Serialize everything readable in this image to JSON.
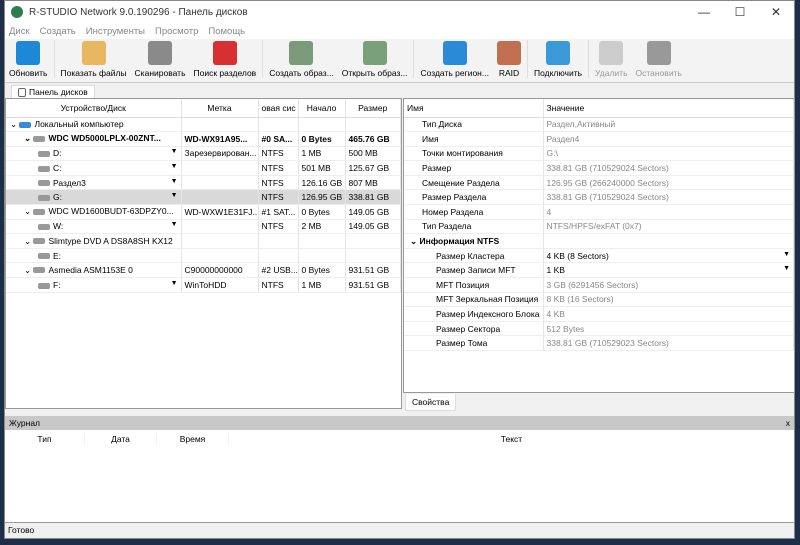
{
  "title": "R-STUDIO Network 9.0.190296 - Панель дисков",
  "menu": [
    "Диск",
    "Создать",
    "Инструменты",
    "Просмотр",
    "Помощь"
  ],
  "toolbar": [
    {
      "label": "Обновить",
      "color": "#1e88d8",
      "disabled": false
    },
    {
      "label": "Показать файлы",
      "color": "#e8b860",
      "disabled": false
    },
    {
      "label": "Сканировать",
      "color": "#8a8a8a",
      "disabled": false
    },
    {
      "label": "Поиск разделов",
      "color": "#d83030",
      "disabled": false
    },
    {
      "label": "Создать образ...",
      "color": "#7a9a7a",
      "disabled": false
    },
    {
      "label": "Открыть образ...",
      "color": "#7aa07a",
      "disabled": false
    },
    {
      "label": "Создать регион...",
      "color": "#2a8ad8",
      "disabled": false
    },
    {
      "label": "RAID",
      "color": "#c07050",
      "disabled": false
    },
    {
      "label": "Подключить",
      "color": "#3a9ad8",
      "disabled": false
    },
    {
      "label": "Удалить",
      "color": "#cccccc",
      "disabled": true
    },
    {
      "label": "Остановить",
      "color": "#999999",
      "disabled": true
    }
  ],
  "tab": "Панель дисков",
  "left": {
    "headers": [
      "Устройство/Диск",
      "Метка",
      "овая сис",
      "Начало",
      "Размер"
    ],
    "rows": [
      {
        "indent": 0,
        "name": "Локальный компьютер",
        "label": "",
        "fs": "",
        "start": "",
        "size": "",
        "bold": false,
        "sel": false,
        "dd": false,
        "exp": true
      },
      {
        "indent": 1,
        "name": "WDC WD5000LPLX-00ZNT...",
        "label": "WD-WX91A95...",
        "fs": "#0 SA...",
        "start": "0 Bytes",
        "size": "465.76 GB",
        "bold": true,
        "sel": false,
        "dd": false,
        "exp": true
      },
      {
        "indent": 2,
        "name": "D:",
        "label": "Зарезервирован...",
        "fs": "NTFS",
        "start": "1 MB",
        "size": "500 MB",
        "bold": false,
        "sel": false,
        "dd": true
      },
      {
        "indent": 2,
        "name": "C:",
        "label": "",
        "fs": "NTFS",
        "start": "501 MB",
        "size": "125.67 GB",
        "bold": false,
        "sel": false,
        "dd": true
      },
      {
        "indent": 2,
        "name": "Раздел3",
        "label": "",
        "fs": "NTFS",
        "start": "126.16 GB",
        "size": "807 MB",
        "bold": false,
        "sel": false,
        "dd": true
      },
      {
        "indent": 2,
        "name": "G:",
        "label": "",
        "fs": "NTFS",
        "start": "126.95 GB",
        "size": "338.81 GB",
        "bold": false,
        "sel": true,
        "dd": true
      },
      {
        "indent": 1,
        "name": "WDC WD1600BUDT-63DPZY0...",
        "label": "WD-WXW1E31FJ...",
        "fs": "#1 SAT...",
        "start": "0 Bytes",
        "size": "149.05 GB",
        "bold": false,
        "sel": false,
        "dd": false,
        "exp": true
      },
      {
        "indent": 2,
        "name": "W:",
        "label": "",
        "fs": "NTFS",
        "start": "2 MB",
        "size": "149.05 GB",
        "bold": false,
        "sel": false,
        "dd": true
      },
      {
        "indent": 1,
        "name": "Slimtype DVD A DS8A8SH KX12",
        "label": "",
        "fs": "",
        "start": "",
        "size": "",
        "bold": false,
        "sel": false,
        "dd": false,
        "exp": true
      },
      {
        "indent": 2,
        "name": "E:",
        "label": "",
        "fs": "",
        "start": "",
        "size": "",
        "bold": false,
        "sel": false,
        "dd": false
      },
      {
        "indent": 1,
        "name": "Asmedia ASM1153E 0",
        "label": "C90000000000",
        "fs": "#2 USB...",
        "start": "0 Bytes",
        "size": "931.51 GB",
        "bold": false,
        "sel": false,
        "dd": false,
        "exp": true
      },
      {
        "indent": 2,
        "name": "F:",
        "label": "WinToHDD",
        "fs": "NTFS",
        "start": "1 MB",
        "size": "931.51 GB",
        "bold": false,
        "sel": false,
        "dd": true
      }
    ]
  },
  "right": {
    "headers": [
      "Имя",
      "Значение"
    ],
    "rows": [
      {
        "name": "Тип Диска",
        "value": "Раздел,Активный",
        "lvl": 1
      },
      {
        "name": "Имя",
        "value": "Раздел4",
        "lvl": 1
      },
      {
        "name": "Точки монтирования",
        "value": "G:\\",
        "lvl": 1
      },
      {
        "name": "Размер",
        "value": "338.81 GB (710529024 Sectors)",
        "lvl": 1
      },
      {
        "name": "Смещение Раздела",
        "value": "126.95 GB (266240000 Sectors)",
        "lvl": 1
      },
      {
        "name": "Размер Раздела",
        "value": "338.81 GB (710529024 Sectors)",
        "lvl": 1
      },
      {
        "name": "Номер Раздела",
        "value": "4",
        "lvl": 1
      },
      {
        "name": "Тип Раздела",
        "value": "NTFS/HPFS/exFAT (0x7)",
        "lvl": 1
      },
      {
        "name": "Информация NTFS",
        "value": "",
        "lvl": 0,
        "group": true
      },
      {
        "name": "Размер Кластера",
        "value": "4 KB (8 Sectors)",
        "lvl": 2,
        "edit": true
      },
      {
        "name": "Размер Записи MFT",
        "value": "1 KB",
        "lvl": 2,
        "edit": true
      },
      {
        "name": "MFT Позиция",
        "value": "3 GB (6291456 Sectors)",
        "lvl": 2
      },
      {
        "name": "MFT Зеркальная Позиция",
        "value": "8 KB (16 Sectors)",
        "lvl": 2
      },
      {
        "name": "Размер Индексного Блока",
        "value": "4 KB",
        "lvl": 2
      },
      {
        "name": "Размер Сектора",
        "value": "512 Bytes",
        "lvl": 2
      },
      {
        "name": "Размер Тома",
        "value": "338.81 GB (710529023 Sectors)",
        "lvl": 2
      }
    ]
  },
  "props_tab": "Свойства",
  "journal": {
    "title": "Журнал",
    "close": "x",
    "cols": [
      "Тип",
      "Дата",
      "Время",
      "Текст"
    ]
  },
  "status": "Готово"
}
